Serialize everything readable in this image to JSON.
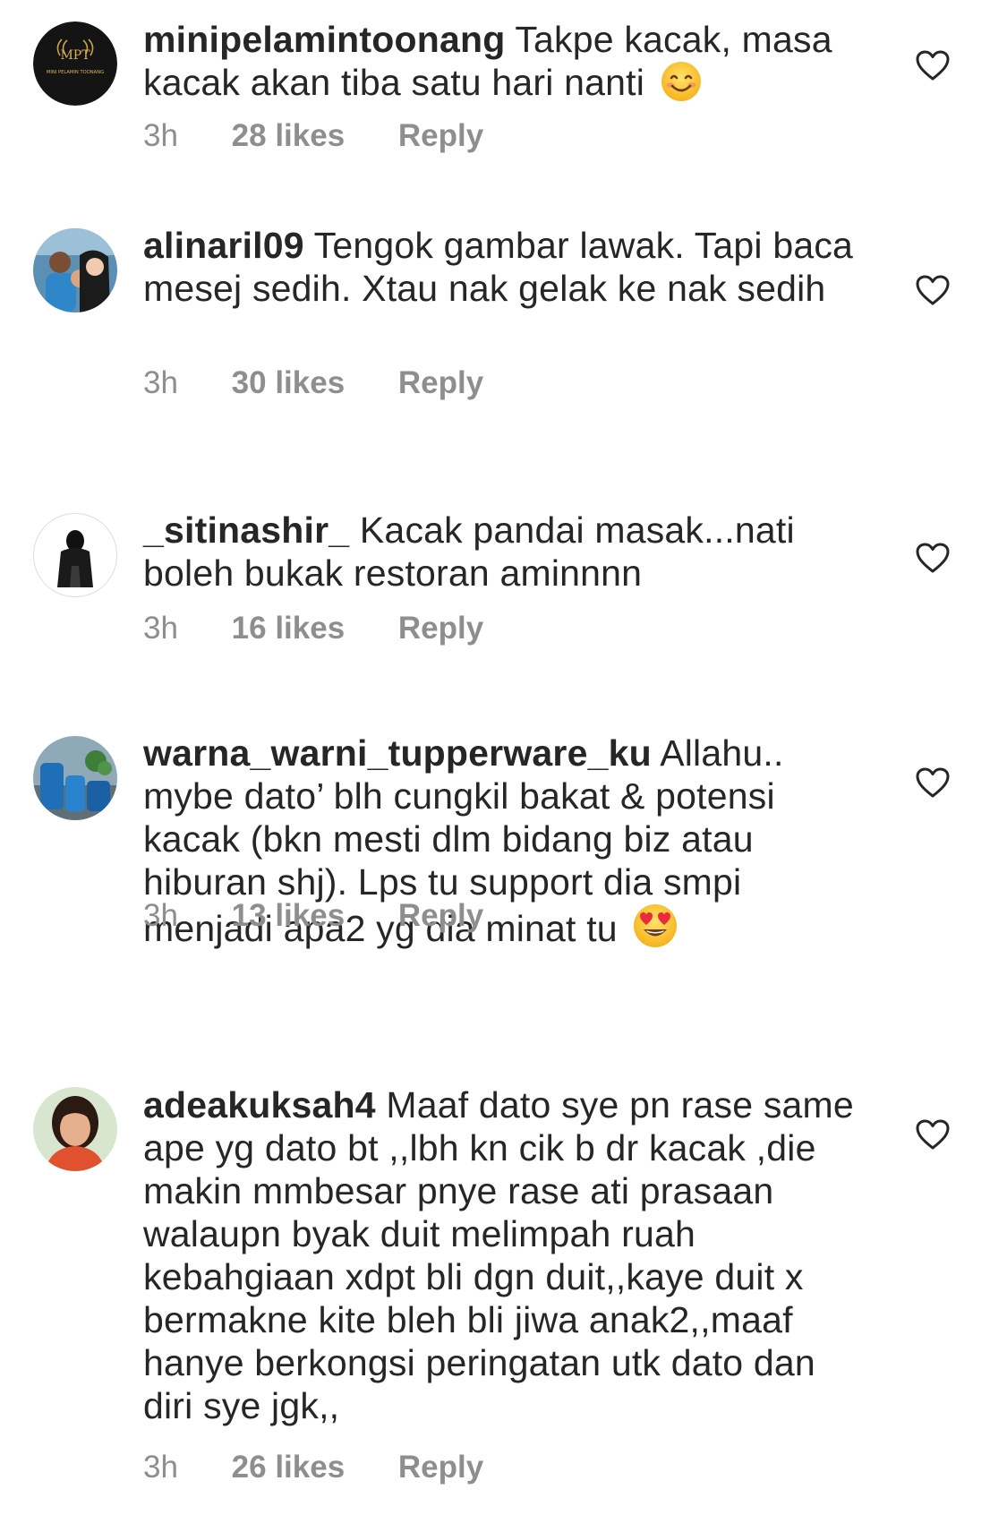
{
  "comments": [
    {
      "username": "minipelamintoonang",
      "text": "Takpe kacak, masa kacak akan tiba satu hari nanti",
      "emoji": "smiling-face",
      "avatar_text": "MPT",
      "avatar_subtext": "MINI PELAMIN TOONANG",
      "time": "3h",
      "likes": "28 likes",
      "reply": "Reply"
    },
    {
      "username": "alinaril09",
      "text": "Tengok gambar lawak. Tapi baca mesej sedih. Xtau nak gelak ke nak sedih",
      "time": "3h",
      "likes": "30 likes",
      "reply": "Reply"
    },
    {
      "username": "_sitinashir_",
      "text": "Kacak pandai masak...nati boleh bukak restoran aminnnn",
      "time": "3h",
      "likes": "16 likes",
      "reply": "Reply"
    },
    {
      "username": "warna_warni_tupperware_ku",
      "text": "Allahu.. mybe dato’ blh cungkil bakat & potensi kacak (bkn mesti dlm bidang biz atau hiburan shj). Lps tu support dia smpi menjadi apa2 yg dia minat tu",
      "emoji": "heart-eyes",
      "time": "3h",
      "likes": "13 likes",
      "reply": "Reply"
    },
    {
      "username": "adeakuksah4",
      "text": "Maaf dato sye pn rase same ape yg dato bt ,,lbh kn cik b dr kacak ,die makin mmbesar pnye rase ati prasaan walaupn byak duit melimpah ruah kebahgiaan xdpt bli dgn duit,,kaye duit x bermakne kite bleh bli jiwa anak2,,maaf hanye berkongsi peringatan utk dato dan diri sye jgk,,",
      "time": "3h",
      "likes": "26 likes",
      "reply": "Reply"
    }
  ],
  "colors": {
    "text": "#262626",
    "meta": "#8e8e8e",
    "heart_stroke": "#262626",
    "background": "#ffffff"
  },
  "icons": {
    "like": "heart-outline-icon"
  }
}
